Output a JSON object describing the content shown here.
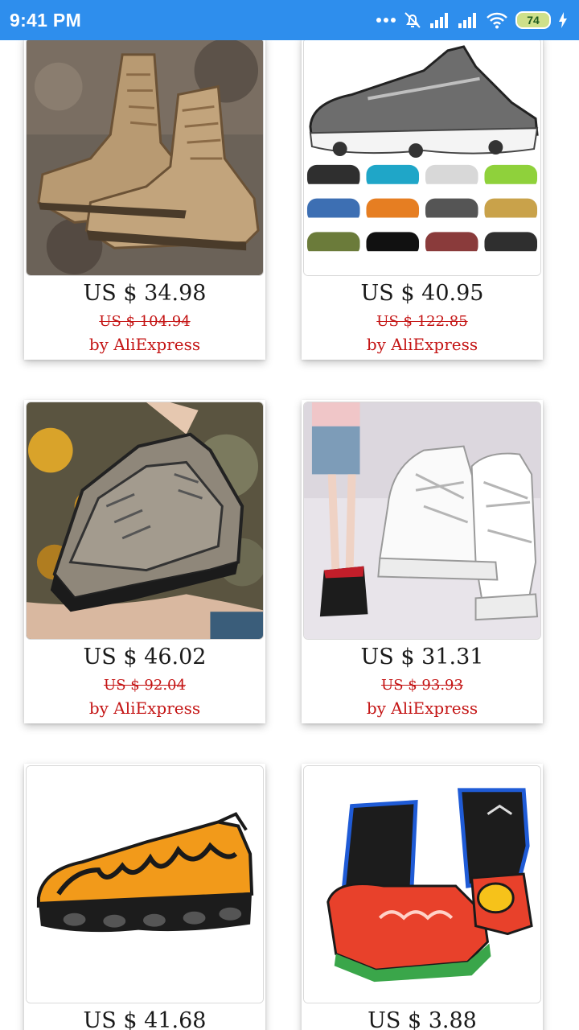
{
  "status_bar": {
    "time": "9:41 PM",
    "battery": "74",
    "icons": [
      "more-dots-icon",
      "mute-icon",
      "signal-icon",
      "signal-icon",
      "wifi-icon",
      "battery-icon",
      "charging-icon"
    ]
  },
  "products": [
    {
      "price": "US $ 34.98",
      "old_price": "US $ 104.94",
      "seller": "by AliExpress",
      "image": "tan-military-boots"
    },
    {
      "price": "US $ 40.95",
      "old_price": "US $ 122.85",
      "seller": "by AliExpress",
      "image": "grey-running-sneaker-colorways"
    },
    {
      "price": "US $ 46.02",
      "old_price": "US $ 92.04",
      "seller": "by AliExpress",
      "image": "grey-hiking-shoes-in-hand"
    },
    {
      "price": "US $ 31.31",
      "old_price": "US $ 93.93",
      "seller": "by AliExpress",
      "image": "white-lace-up-platform-boots"
    },
    {
      "price": "US $ 41.68",
      "image": "orange-air-sneaker"
    },
    {
      "price": "US $ 3.88",
      "image": "trail-running-gaiters"
    }
  ]
}
